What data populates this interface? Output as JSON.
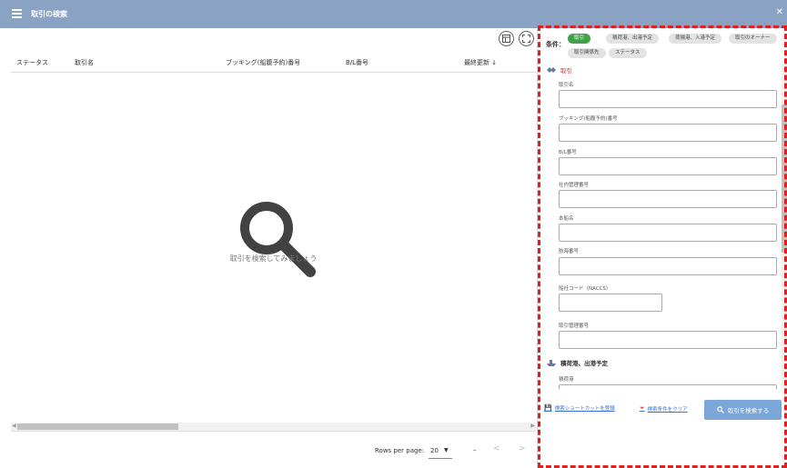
{
  "window": {
    "title": "取引の検索",
    "close_glyph": "✕"
  },
  "table": {
    "columns": [
      {
        "label": "ステータス"
      },
      {
        "label": "取引名"
      },
      {
        "label": "ブッキング(船腹予約)番号"
      },
      {
        "label": "B/L番号"
      },
      {
        "label": "最終更新 ↓"
      }
    ],
    "empty_message": "取引を検索してみましょう",
    "pager": {
      "rows_per_page_label": "Rows per page:",
      "rows_per_page_value": "20",
      "range": "–"
    }
  },
  "conditions": {
    "label": "条件：",
    "chips": [
      {
        "label": "取引",
        "active": true
      },
      {
        "label": "積荷港、出港予定",
        "active": false
      },
      {
        "label": "荷揚港、入港予定",
        "active": false
      },
      {
        "label": "取引のオーナー",
        "active": false
      },
      {
        "label": "取引関係先",
        "active": false
      },
      {
        "label": "ステータス",
        "active": false
      }
    ]
  },
  "sections": {
    "trade": {
      "title": "取引",
      "fields": [
        {
          "label": "取引名",
          "value": ""
        },
        {
          "label": "ブッキング(船腹予約)番号",
          "value": ""
        },
        {
          "label": "B/L番号",
          "value": ""
        },
        {
          "label": "社内管理番号",
          "value": ""
        },
        {
          "label": "本船名",
          "value": ""
        },
        {
          "label": "航海番号",
          "value": ""
        },
        {
          "label": "船社コード（NACCS）",
          "value": ""
        },
        {
          "label": "取引管理番号",
          "value": ""
        }
      ]
    },
    "loading": {
      "title": "積荷港、出港予定",
      "fields": [
        {
          "label": "積荷港",
          "value": ""
        }
      ]
    }
  },
  "actions": {
    "save_shortcut": "検索ショートカットを登録",
    "clear_conditions": "検索条件をクリア",
    "search_button": "取引を検索する"
  },
  "colors": {
    "titlebar": "#8aa3c4",
    "accent_red": "#e02020",
    "chip_active": "#43a04a",
    "search_button": "#7aa6d8"
  },
  "icons": [
    "list-icon",
    "close-icon",
    "column-settings-icon",
    "expand-icon",
    "search-icon",
    "handshake-icon",
    "ship-icon",
    "save-icon",
    "filter-clear-icon"
  ]
}
